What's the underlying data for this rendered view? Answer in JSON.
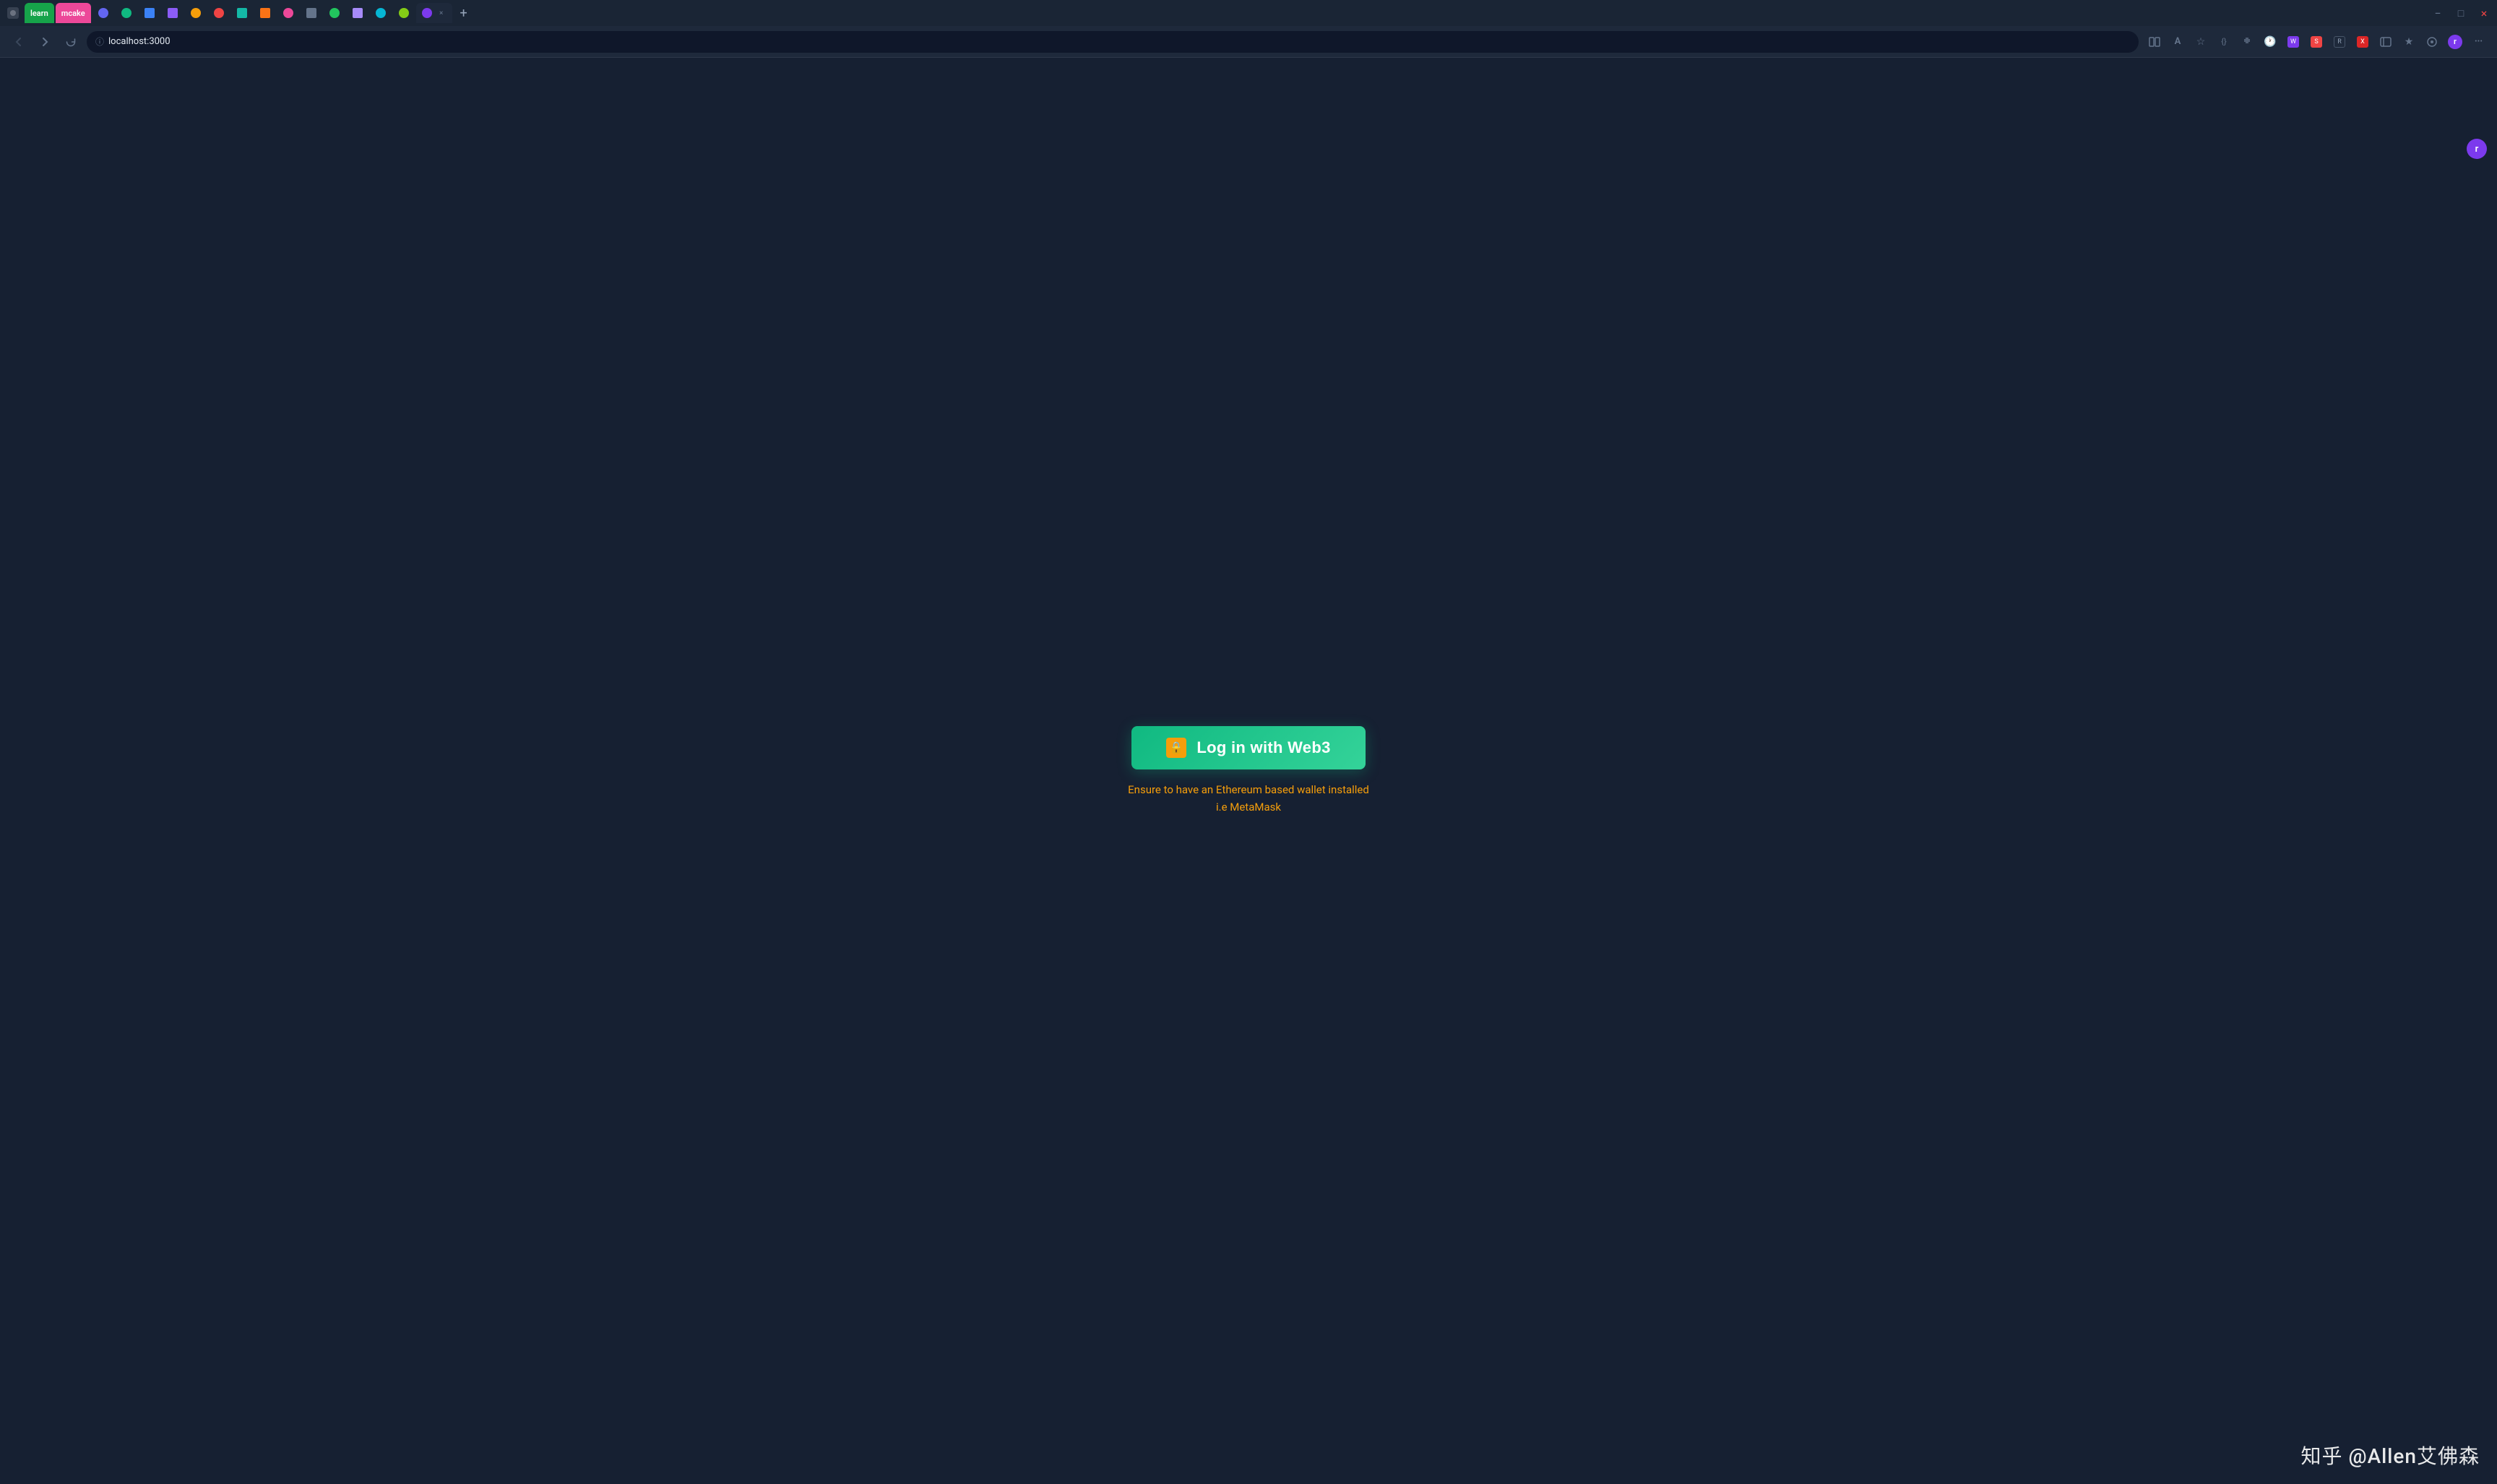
{
  "browser": {
    "tabs": [
      {
        "id": "learn",
        "label": "learn",
        "type": "special-green",
        "active": false
      },
      {
        "id": "mcake",
        "label": "mcake",
        "type": "special-pink",
        "active": false
      },
      {
        "id": "tab3",
        "label": "",
        "type": "icon",
        "active": false
      },
      {
        "id": "tab4",
        "label": "",
        "type": "icon",
        "active": false
      },
      {
        "id": "tab5",
        "label": "",
        "type": "icon",
        "active": false
      },
      {
        "id": "tab6",
        "label": "",
        "type": "icon",
        "active": false
      },
      {
        "id": "tab7",
        "label": "",
        "type": "icon",
        "active": false
      },
      {
        "id": "active-tab",
        "label": "",
        "type": "active",
        "active": true
      }
    ],
    "address": "localhost:3000",
    "new_tab_label": "+",
    "minimize_label": "−",
    "maximize_label": "□",
    "close_label": "×"
  },
  "main": {
    "login_button_label": "Log in with Web3",
    "hint_line1": "Ensure to have an Ethereum based wallet installed",
    "hint_line2": "i.e MetaMask",
    "wallet_icon": "🔒",
    "watermark": "知乎 @Allen艾佛森",
    "profile_letter": "r"
  }
}
